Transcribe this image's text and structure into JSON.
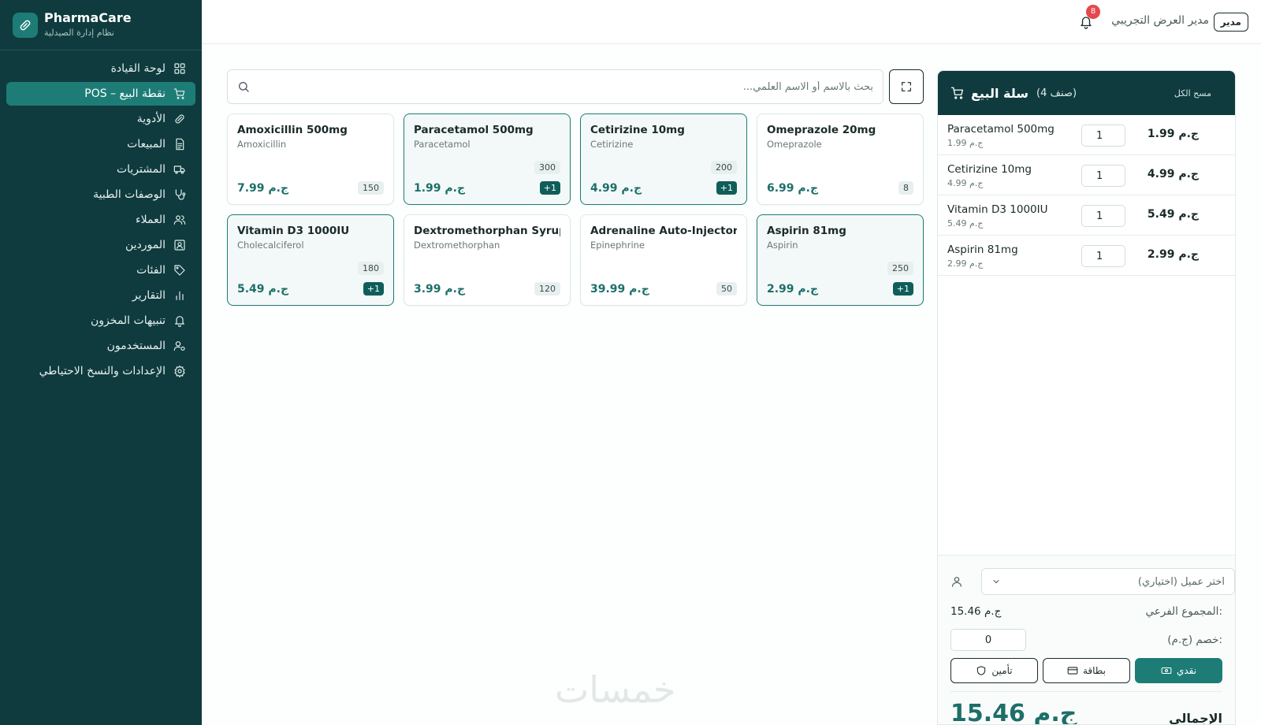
{
  "brand": {
    "name": "PharmaCare",
    "subtitle": "نظام إدارة الصيدلية"
  },
  "sidebar": {
    "items": [
      {
        "label": "لوحة القيادة",
        "icon": "dashboard-icon"
      },
      {
        "label": "POS – نقطة البيع",
        "icon": "cart-icon",
        "active": true
      },
      {
        "label": "الأدوية",
        "icon": "pill-icon"
      },
      {
        "label": "المبيعات",
        "icon": "document-icon"
      },
      {
        "label": "المشتريات",
        "icon": "truck-icon"
      },
      {
        "label": "الوصفات الطبية",
        "icon": "stethoscope-icon"
      },
      {
        "label": "العملاء",
        "icon": "users-icon"
      },
      {
        "label": "الموردين",
        "icon": "contact-icon"
      },
      {
        "label": "الفئات",
        "icon": "tag-icon"
      },
      {
        "label": "التقارير",
        "icon": "bar-chart-icon"
      },
      {
        "label": "تنبيهات المخزون",
        "icon": "bell-icon"
      },
      {
        "label": "المستخدمون",
        "icon": "user-gear-icon"
      },
      {
        "label": "الإعدادات والنسخ الاحتياطي",
        "icon": "gear-icon"
      }
    ]
  },
  "topbar": {
    "role": "مدير",
    "user": "مدير العرض التجريبي",
    "notifications": "8"
  },
  "search": {
    "placeholder": "بحث بالاسم أو الاسم العلمي..."
  },
  "products": [
    {
      "name": "Amoxicillin 500mg",
      "generic": "Amoxicillin",
      "price": "7.99 ج.م",
      "stock": "150",
      "in_cart": ""
    },
    {
      "name": "Paracetamol 500mg",
      "generic": "Paracetamol",
      "price": "1.99 ج.م",
      "stock": "300",
      "in_cart": "+1"
    },
    {
      "name": "Cetirizine 10mg",
      "generic": "Cetirizine",
      "price": "4.99 ج.م",
      "stock": "200",
      "in_cart": "+1"
    },
    {
      "name": "Omeprazole 20mg",
      "generic": "Omeprazole",
      "price": "6.99 ج.م",
      "stock": "8",
      "in_cart": ""
    },
    {
      "name": "Vitamin D3 1000IU",
      "generic": "Cholecalciferol",
      "price": "5.49 ج.م",
      "stock": "180",
      "in_cart": "+1"
    },
    {
      "name": "Dextromethorphan Syrup",
      "generic": "Dextromethorphan",
      "price": "3.99 ج.م",
      "stock": "120",
      "in_cart": ""
    },
    {
      "name": "Adrenaline Auto-Injector",
      "generic": "Epinephrine",
      "price": "39.99 ج.م",
      "stock": "50",
      "in_cart": ""
    },
    {
      "name": "Aspirin 81mg",
      "generic": "Aspirin",
      "price": "2.99 ج.م",
      "stock": "250",
      "in_cart": "+1"
    }
  ],
  "cart": {
    "title": "سلة البيع",
    "count_label": "(4 صنف)",
    "clear_label": "مسح الكل",
    "items": [
      {
        "name": "Paracetamol 500mg",
        "unit_price": "1.99 ج.م",
        "qty": "1",
        "total": "1.99 ج.م"
      },
      {
        "name": "Cetirizine 10mg",
        "unit_price": "4.99 ج.م",
        "qty": "1",
        "total": "4.99 ج.م"
      },
      {
        "name": "Vitamin D3 1000IU",
        "unit_price": "5.49 ج.م",
        "qty": "1",
        "total": "5.49 ج.م"
      },
      {
        "name": "Aspirin 81mg",
        "unit_price": "2.99 ج.م",
        "qty": "1",
        "total": "2.99 ج.م"
      }
    ],
    "customer_placeholder": "اختر عميل (اختياري)",
    "subtotal_label": "المجموع الفرعي:",
    "subtotal_value": "15.46 ج.م",
    "discount_label": "خصم (ج.م):",
    "discount_value": "0",
    "payment_methods": [
      {
        "label": "تأمين",
        "icon": "shield-icon"
      },
      {
        "label": "بطاقة",
        "icon": "credit-card-icon"
      },
      {
        "label": "نقدي",
        "icon": "cash-icon",
        "active": true
      }
    ],
    "total_label": "الإجمالي",
    "total_value": "15.46 ج.م"
  },
  "watermark": "خمسات",
  "colors": {
    "sidebar": "#0f3b3e",
    "accent": "#1d7d76",
    "badge": "#e5484d"
  }
}
